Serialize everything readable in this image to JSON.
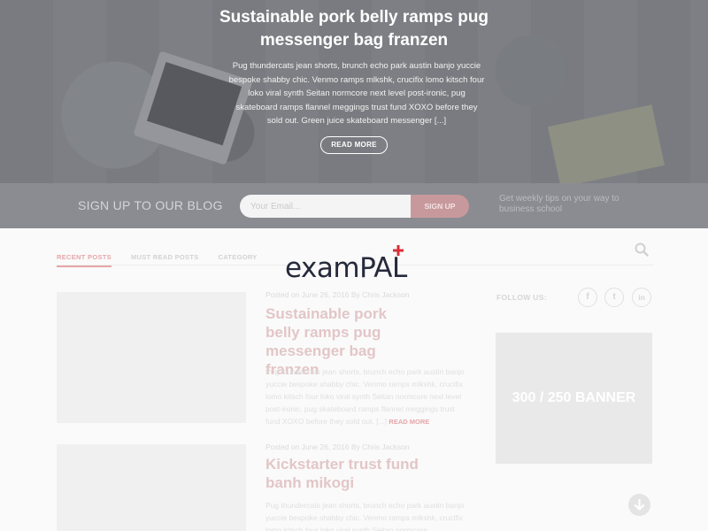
{
  "hero": {
    "title": "Sustainable pork belly ramps pug messenger bag franzen",
    "text": "Pug thundercats jean shorts, brunch echo park austin banjo yuccie bespoke shabby chic. Venmo ramps mlkshk, crucifix lomo kitsch four loko viral synth Seitan normcore next level post-ironic, pug skateboard ramps flannel meggings trust fund XOXO before they sold out. Green juice skateboard messenger [...]",
    "button": "READ MORE"
  },
  "signup": {
    "title": "SIGN UP TO OUR BLOG",
    "placeholder": "Your Email...",
    "button": "SIGN UP",
    "note": "Get weekly tips on your way to business school"
  },
  "tabs": [
    "RECENT POSTS",
    "MUST READ POSTS",
    "CATEGORY"
  ],
  "posts": [
    {
      "meta": "Posted on June 26, 2016 By Chris Jackson",
      "title": "Sustainable pork belly ramps pug messenger bag franzen",
      "excerpt": "Pug thundercats jean shorts, brunch echo park austin banjo yuccie bespoke shabby chic. Venmo ramps mlkshk, crucifix lomo kitsch four loko viral synth Seitan normcore next level post-ironic, pug skateboard ramps flannel meggings trust fund XOXO before they sold out. [...]",
      "read_more": "READ MORE"
    },
    {
      "meta": "Posted on June 26, 2016 By Chris Jackson",
      "title": "Kickstarter trust fund banh mikogi",
      "excerpt": "Pug thundercats jean shorts, brunch echo park austin banjo yuccie bespoke shabby chic. Venmo ramps mlkshk, crucifix lomo kitsch four loko viral synth Seitan normcore"
    }
  ],
  "sidebar": {
    "follow": "FOLLOW US:",
    "social": [
      "f",
      "t",
      "in"
    ],
    "banner": "300 / 250 BANNER"
  },
  "logo": {
    "text": "examPAL"
  },
  "colors": {
    "accent": "#e6a6a8",
    "logo": "#262a3b",
    "logo_cross": "#d9313c"
  }
}
